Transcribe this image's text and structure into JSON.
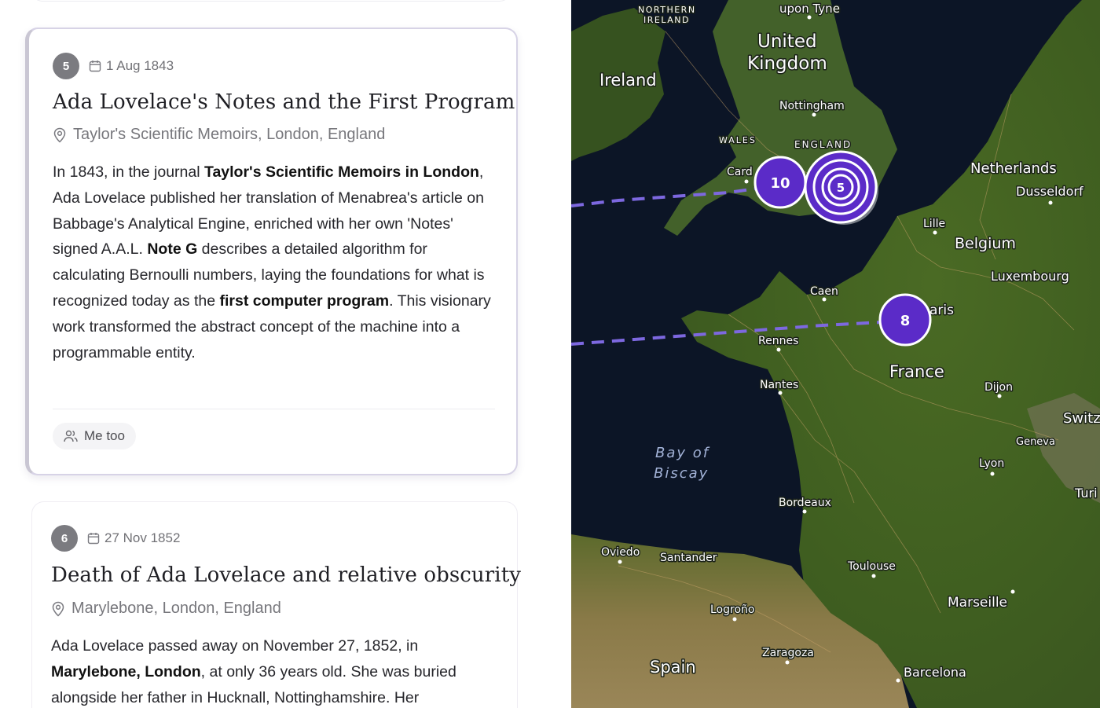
{
  "events": [
    {
      "number": "5",
      "date": "1 Aug 1843",
      "title": "Ada Lovelace's Notes and the First Program",
      "location": "Taylor's Scientific Memoirs, London, England",
      "body": [
        {
          "t": "In 1843, in the journal "
        },
        {
          "t": "Taylor's Scientific Memoirs in London",
          "b": true
        },
        {
          "t": ", Ada Lovelace published her translation of Menabrea's article on Babbage's Analytical Engine, enriched with her own 'Notes' signed A.A.L. "
        },
        {
          "t": "Note G",
          "b": true
        },
        {
          "t": " describes a detailed algorithm for calculating Bernoulli numbers, laying the foundations for what is recognized today as the "
        },
        {
          "t": "first computer program",
          "b": true
        },
        {
          "t": ". This visionary work transformed the abstract concept of the machine into a programmable entity."
        }
      ],
      "action_label": "Me too"
    },
    {
      "number": "6",
      "date": "27 Nov 1852",
      "title": "Death of Ada Lovelace and relative obscurity",
      "location": "Marylebone, London, England",
      "body": [
        {
          "t": "Ada Lovelace passed away on November 27, 1852, in "
        },
        {
          "t": "Marylebone, London",
          "b": true
        },
        {
          "t": ", at only 36 years old. She was buried alongside her father in Hucknall, Nottinghamshire. Her"
        }
      ]
    }
  ],
  "map": {
    "labels": {
      "northern_ireland_1": "NORTHERN",
      "northern_ireland_2": "IRELAND",
      "upon_tyne": "upon Tyne",
      "united": "United",
      "kingdom": "Kingdom",
      "ireland": "Ireland",
      "nottingham": "Nottingham",
      "wales": "WALES",
      "england": "ENGLAND",
      "cardiff": "Card",
      "netherlands": "Netherlands",
      "dusseldorf": "Dusseldorf",
      "lille": "Lille",
      "belgium": "Belgium",
      "luxembourg": "Luxembourg",
      "caen": "Caen",
      "paris": "aris",
      "rennes": "Rennes",
      "france": "France",
      "nantes": "Nantes",
      "dijon": "Dijon",
      "switz": "Switz",
      "geneva": "Geneva",
      "lyon": "Lyon",
      "turin": "Turi",
      "bay_of": "Bay of",
      "biscay": "Biscay",
      "bordeaux": "Bordeaux",
      "oviedo": "Oviedo",
      "santander": "Santander",
      "toulouse": "Toulouse",
      "logrono": "Logroño",
      "marseille": "Marseille",
      "zaragoza": "Zaragoza",
      "spain": "Spain",
      "barcelona": "Barcelona"
    },
    "clusters": {
      "london_small": "10",
      "london_selected": "5",
      "paris": "8"
    },
    "colors": {
      "cluster": "#5b2bc8",
      "route": "#7d68e0"
    }
  }
}
